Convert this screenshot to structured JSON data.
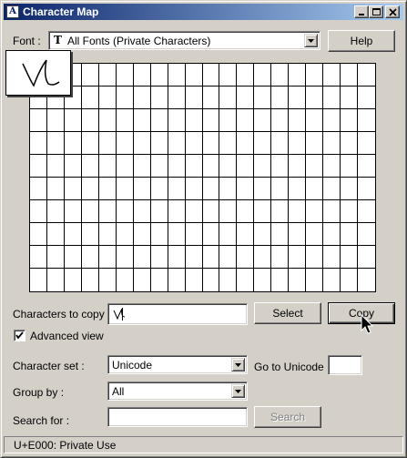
{
  "window": {
    "title": "Character Map"
  },
  "font": {
    "label": "Font :",
    "value": "All Fonts (Private Characters)",
    "icon": "truetype-icon"
  },
  "buttons": {
    "help": "Help",
    "select": "Select",
    "copy": "Copy",
    "search": "Search"
  },
  "grid": {
    "columns": 20,
    "rows": 10
  },
  "copy_field": {
    "label": "Characters to copy :",
    "value": ""
  },
  "advanced": {
    "label": "Advanced view",
    "checked": true
  },
  "charset": {
    "label": "Character set :",
    "value": "Unicode"
  },
  "goto": {
    "label": "Go to Unicode :",
    "value": ""
  },
  "group": {
    "label": "Group by :",
    "value": "All"
  },
  "search": {
    "label": "Search for :",
    "value": ""
  },
  "status": {
    "text": "U+E000: Private Use"
  },
  "colors": {
    "title_start": "#0a246a",
    "title_end": "#a6caf0",
    "face": "#d4d0c8"
  }
}
